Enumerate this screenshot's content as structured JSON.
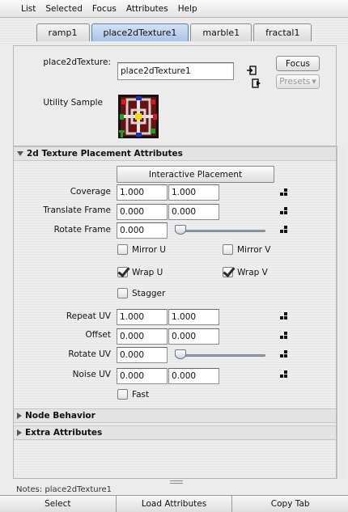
{
  "menu": [
    "List",
    "Selected",
    "Focus",
    "Attributes",
    "Help"
  ],
  "tabs": [
    {
      "label": "ramp1",
      "active": false
    },
    {
      "label": "place2dTexture1",
      "active": true
    },
    {
      "label": "marble1",
      "active": false
    },
    {
      "label": "fractal1",
      "active": false
    }
  ],
  "node": {
    "type_label": "place2dTexture:",
    "name_value": "place2dTexture1",
    "focus_label": "Focus",
    "presets_label": "Presets",
    "sample_label": "Utility Sample"
  },
  "placement": {
    "header": "2d Texture Placement Attributes",
    "interactive_label": "Interactive Placement",
    "coverage": {
      "label": "Coverage",
      "u": "1.000",
      "v": "1.000"
    },
    "translate_frame": {
      "label": "Translate Frame",
      "u": "0.000",
      "v": "0.000"
    },
    "rotate_frame": {
      "label": "Rotate Frame",
      "value": "0.000",
      "slider_fraction": 0.0
    },
    "mirror_u": {
      "label": "Mirror U",
      "checked": false
    },
    "mirror_v": {
      "label": "Mirror V",
      "checked": false
    },
    "wrap_u": {
      "label": "Wrap U",
      "checked": true
    },
    "wrap_v": {
      "label": "Wrap V",
      "checked": true
    },
    "stagger": {
      "label": "Stagger",
      "checked": false
    },
    "repeat_uv": {
      "label": "Repeat UV",
      "u": "1.000",
      "v": "1.000"
    },
    "offset": {
      "label": "Offset",
      "u": "0.000",
      "v": "0.000"
    },
    "rotate_uv": {
      "label": "Rotate UV",
      "value": "0.000",
      "slider_fraction": 0.0
    },
    "noise_uv": {
      "label": "Noise UV",
      "u": "0.000",
      "v": "0.000"
    },
    "fast": {
      "label": "Fast",
      "checked": false
    }
  },
  "collapsed_sections": [
    "Node Behavior",
    "Extra Attributes"
  ],
  "notes": "Notes:  place2dTexture1",
  "bottom_buttons": [
    "Select",
    "Load Attributes",
    "Copy Tab"
  ]
}
